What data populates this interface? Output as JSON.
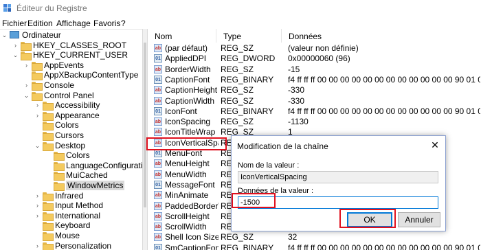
{
  "window": {
    "title": "Éditeur du Registre"
  },
  "menu": [
    "Fichier",
    "Edition",
    "Affichage",
    "Favoris",
    "?"
  ],
  "tree": [
    {
      "label": "Ordinateur",
      "depth": 0,
      "expand": "open",
      "icon": "computer-icon"
    },
    {
      "label": "HKEY_CLASSES_ROOT",
      "depth": 1,
      "expand": "closed"
    },
    {
      "label": "HKEY_CURRENT_USER",
      "depth": 1,
      "expand": "open"
    },
    {
      "label": "AppEvents",
      "depth": 2,
      "expand": "closed"
    },
    {
      "label": "AppXBackupContentType",
      "depth": 2,
      "expand": "none"
    },
    {
      "label": "Console",
      "depth": 2,
      "expand": "closed"
    },
    {
      "label": "Control Panel",
      "depth": 2,
      "expand": "open"
    },
    {
      "label": "Accessibility",
      "depth": 3,
      "expand": "closed"
    },
    {
      "label": "Appearance",
      "depth": 3,
      "expand": "closed"
    },
    {
      "label": "Colors",
      "depth": 3,
      "expand": "none"
    },
    {
      "label": "Cursors",
      "depth": 3,
      "expand": "none"
    },
    {
      "label": "Desktop",
      "depth": 3,
      "expand": "open"
    },
    {
      "label": "Colors",
      "depth": 4,
      "expand": "none"
    },
    {
      "label": "LanguageConfiguration",
      "depth": 4,
      "expand": "none"
    },
    {
      "label": "MuiCached",
      "depth": 4,
      "expand": "none"
    },
    {
      "label": "WindowMetrics",
      "depth": 4,
      "expand": "none",
      "selected": true
    },
    {
      "label": "Infrared",
      "depth": 3,
      "expand": "closed"
    },
    {
      "label": "Input Method",
      "depth": 3,
      "expand": "closed"
    },
    {
      "label": "International",
      "depth": 3,
      "expand": "closed"
    },
    {
      "label": "Keyboard",
      "depth": 3,
      "expand": "none"
    },
    {
      "label": "Mouse",
      "depth": 3,
      "expand": "none"
    },
    {
      "label": "Personalization",
      "depth": 3,
      "expand": "closed"
    }
  ],
  "columns": {
    "name": "Nom",
    "type": "Type",
    "data": "Données"
  },
  "values": [
    {
      "name": "(par défaut)",
      "type": "REG_SZ",
      "data": "(valeur non définie)",
      "kind": "sz"
    },
    {
      "name": "AppliedDPI",
      "type": "REG_DWORD",
      "data": "0x00000060 (96)",
      "kind": "bin"
    },
    {
      "name": "BorderWidth",
      "type": "REG_SZ",
      "data": "-15",
      "kind": "sz"
    },
    {
      "name": "CaptionFont",
      "type": "REG_BINARY",
      "data": "f4 ff ff ff 00 00 00 00 00 00 00 00 00 00 00 00 90 01 0...",
      "kind": "bin"
    },
    {
      "name": "CaptionHeight",
      "type": "REG_SZ",
      "data": "-330",
      "kind": "sz"
    },
    {
      "name": "CaptionWidth",
      "type": "REG_SZ",
      "data": "-330",
      "kind": "sz"
    },
    {
      "name": "IconFont",
      "type": "REG_BINARY",
      "data": "f4 ff ff ff 00 00 00 00 00 00 00 00 00 00 00 00 90 01 0...",
      "kind": "bin"
    },
    {
      "name": "IconSpacing",
      "type": "REG_SZ",
      "data": "-1130",
      "kind": "sz"
    },
    {
      "name": "IconTitleWrap",
      "type": "REG_SZ",
      "data": "1",
      "kind": "sz"
    },
    {
      "name": "IconVerticalSpac...",
      "type": "REG",
      "data": "",
      "kind": "sz"
    },
    {
      "name": "MenuFont",
      "type": "REG",
      "data": "",
      "kind": "bin"
    },
    {
      "name": "MenuHeight",
      "type": "REG",
      "data": "",
      "kind": "sz"
    },
    {
      "name": "MenuWidth",
      "type": "REG",
      "data": "",
      "kind": "sz"
    },
    {
      "name": "MessageFont",
      "type": "REG",
      "data": "",
      "kind": "bin"
    },
    {
      "name": "MinAnimate",
      "type": "REG",
      "data": "",
      "kind": "sz"
    },
    {
      "name": "PaddedBorderW...",
      "type": "REG",
      "data": "",
      "kind": "sz"
    },
    {
      "name": "ScrollHeight",
      "type": "REG",
      "data": "",
      "kind": "sz"
    },
    {
      "name": "ScrollWidth",
      "type": "REG",
      "data": "",
      "kind": "sz"
    },
    {
      "name": "Shell Icon Size",
      "type": "REG_SZ",
      "data": "32",
      "kind": "sz"
    },
    {
      "name": "SmCaptionFont",
      "type": "REG_BINARY",
      "data": "f4 ff ff ff 00 00 00 00 00 00 00 00 00 00 00 00 90 01 0...",
      "kind": "bin"
    }
  ],
  "dialog": {
    "title": "Modification de la chaîne",
    "name_label": "Nom de la valeur :",
    "name_value": "IconVerticalSpacing",
    "data_label": "Données de la valeur :",
    "data_value": "-1500",
    "ok_label": "OK",
    "cancel_label": "Annuler"
  },
  "colors": {
    "highlight": "#e0101e",
    "selection": "#d9d9d9",
    "accent": "#0078d7"
  }
}
